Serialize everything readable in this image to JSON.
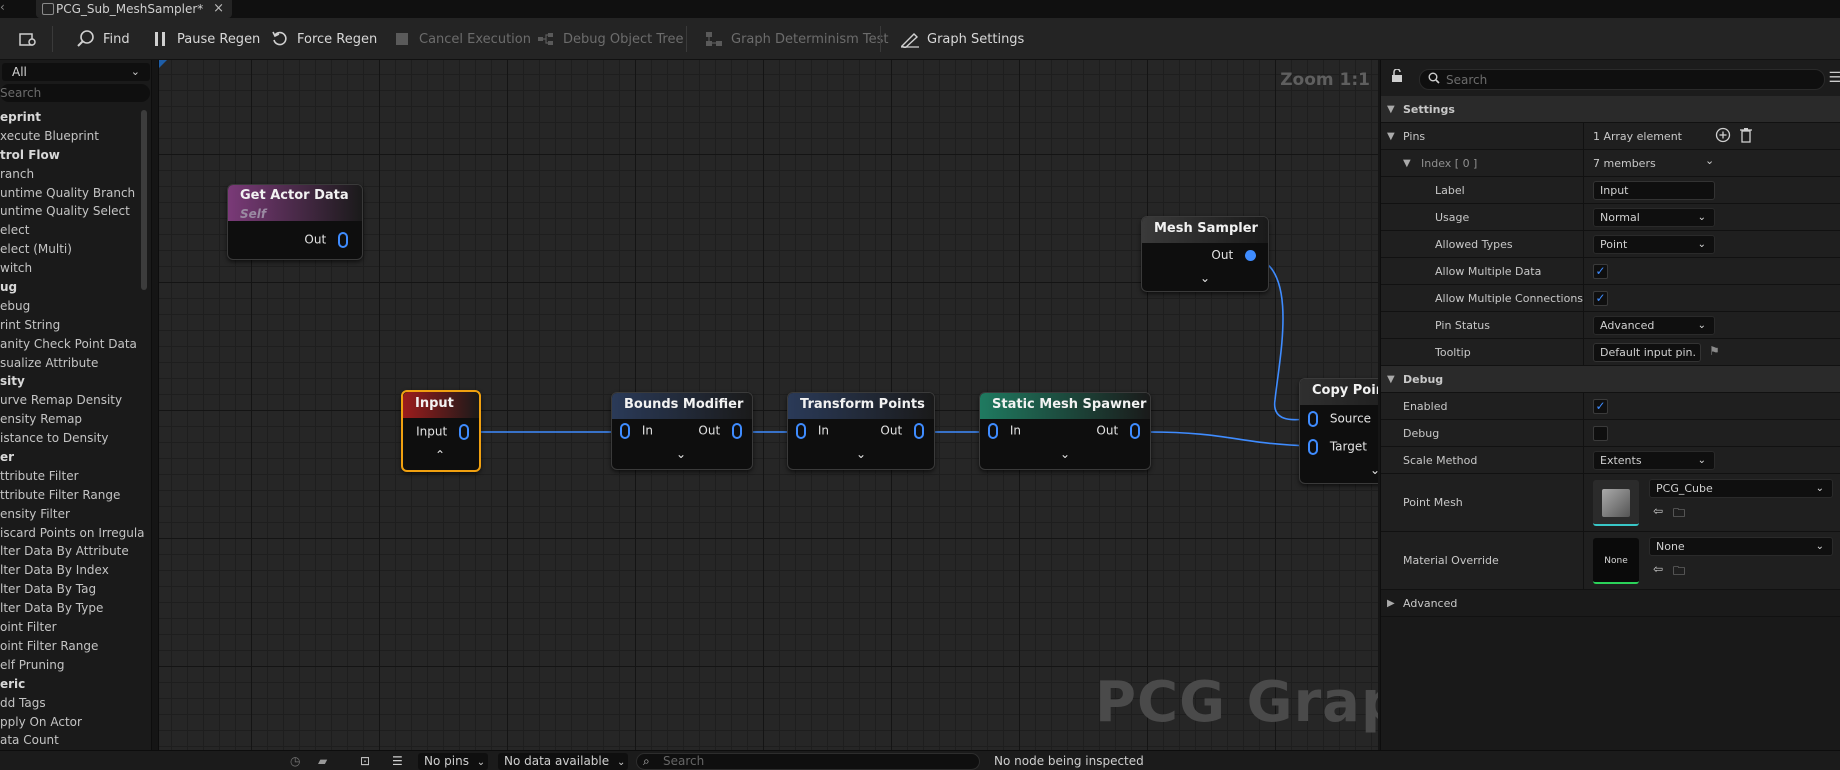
{
  "tab": {
    "title": "PCG_Sub_MeshSampler*",
    "close": "×"
  },
  "toolbar": {
    "find": "Find",
    "pause_regen": "Pause Regen",
    "force_regen": "Force Regen",
    "cancel_execution": "Cancel Execution",
    "debug_object_tree": "Debug Object Tree",
    "graph_determinism_test": "Graph Determinism Test",
    "graph_settings": "Graph Settings"
  },
  "palette": {
    "filter": "All",
    "search_placeholder": "Search",
    "items": [
      {
        "label": "eprint",
        "category": true
      },
      {
        "label": "xecute Blueprint",
        "category": false
      },
      {
        "label": "trol Flow",
        "category": true
      },
      {
        "label": "ranch",
        "category": false
      },
      {
        "label": "untime Quality Branch",
        "category": false
      },
      {
        "label": "untime Quality Select",
        "category": false
      },
      {
        "label": "elect",
        "category": false
      },
      {
        "label": "elect (Multi)",
        "category": false
      },
      {
        "label": "witch",
        "category": false
      },
      {
        "label": "ug",
        "category": true
      },
      {
        "label": "ebug",
        "category": false
      },
      {
        "label": "rint String",
        "category": false
      },
      {
        "label": "anity Check Point Data",
        "category": false
      },
      {
        "label": "sualize Attribute",
        "category": false
      },
      {
        "label": "sity",
        "category": true
      },
      {
        "label": "urve Remap Density",
        "category": false
      },
      {
        "label": "ensity Remap",
        "category": false
      },
      {
        "label": "istance to Density",
        "category": false
      },
      {
        "label": "er",
        "category": true
      },
      {
        "label": "ttribute Filter",
        "category": false
      },
      {
        "label": "ttribute Filter Range",
        "category": false
      },
      {
        "label": "ensity Filter",
        "category": false
      },
      {
        "label": "iscard Points on Irregula",
        "category": false
      },
      {
        "label": "lter Data By Attribute",
        "category": false
      },
      {
        "label": "lter Data By Index",
        "category": false
      },
      {
        "label": "lter Data By Tag",
        "category": false
      },
      {
        "label": "lter Data By Type",
        "category": false
      },
      {
        "label": "oint Filter",
        "category": false
      },
      {
        "label": "oint Filter Range",
        "category": false
      },
      {
        "label": "elf Pruning",
        "category": false
      },
      {
        "label": "eric",
        "category": true
      },
      {
        "label": "dd Tags",
        "category": false
      },
      {
        "label": "pply On Actor",
        "category": false
      },
      {
        "label": "ata Count",
        "category": false
      }
    ]
  },
  "graph": {
    "zoom": "Zoom 1:1",
    "watermark": "PCG Graph",
    "nodes": {
      "get_actor_data": {
        "title": "Get Actor Data",
        "subtitle": "Self",
        "out": "Out"
      },
      "mesh_sampler": {
        "title": "Mesh Sampler",
        "out": "Out"
      },
      "input": {
        "title": "Input",
        "pin": "Input"
      },
      "bounds_modifier": {
        "title": "Bounds Modifier",
        "in": "In",
        "out": "Out"
      },
      "transform_points": {
        "title": "Transform Points",
        "in": "In",
        "out": "Out"
      },
      "static_mesh_spawner": {
        "title": "Static Mesh Spawner",
        "in": "In",
        "out": "Out"
      },
      "copy_points": {
        "title": "Copy Points",
        "source": "Source",
        "target": "Target"
      }
    },
    "colors": {
      "get_actor_data": "#7a3a78",
      "mesh_sampler": "#3a3a3a",
      "input": "#9c1c1c",
      "bounds_modifier": "#2a3a58",
      "transform_points": "#2a3a58",
      "static_mesh_spawner": "#1f7a60",
      "copy_points": "#2f2f2f",
      "wire": "#3f8cff",
      "selection": "#f0a010"
    }
  },
  "details": {
    "search_placeholder": "Search",
    "settings_section": "Settings",
    "pins_label": "Pins",
    "pins_value": "1 Array element",
    "index_label": "Index [ 0 ]",
    "index_value": "7 members",
    "label_label": "Label",
    "label_value": "Input",
    "usage_label": "Usage",
    "usage_value": "Normal",
    "allowed_types_label": "Allowed Types",
    "allowed_types_value": "Point",
    "allow_multiple_data_label": "Allow Multiple Data",
    "allow_multiple_data_checked": true,
    "allow_multiple_connections_label": "Allow Multiple Connections",
    "allow_multiple_connections_checked": true,
    "pin_status_label": "Pin Status",
    "pin_status_value": "Advanced",
    "tooltip_label": "Tooltip",
    "tooltip_value": "Default input pin.",
    "debug_section": "Debug",
    "enabled_label": "Enabled",
    "enabled_checked": true,
    "debug_label": "Debug",
    "debug_checked": false,
    "scale_method_label": "Scale Method",
    "scale_method_value": "Extents",
    "point_mesh_label": "Point Mesh",
    "point_mesh_value": "PCG_Cube",
    "material_override_label": "Material Override",
    "material_override_value": "None",
    "material_thumb_text": "None",
    "advanced_section": "Advanced"
  },
  "bottombar": {
    "pins_filter": "No pins",
    "data_filter": "No data available",
    "search_placeholder": "Search",
    "status": "No node being inspected"
  }
}
